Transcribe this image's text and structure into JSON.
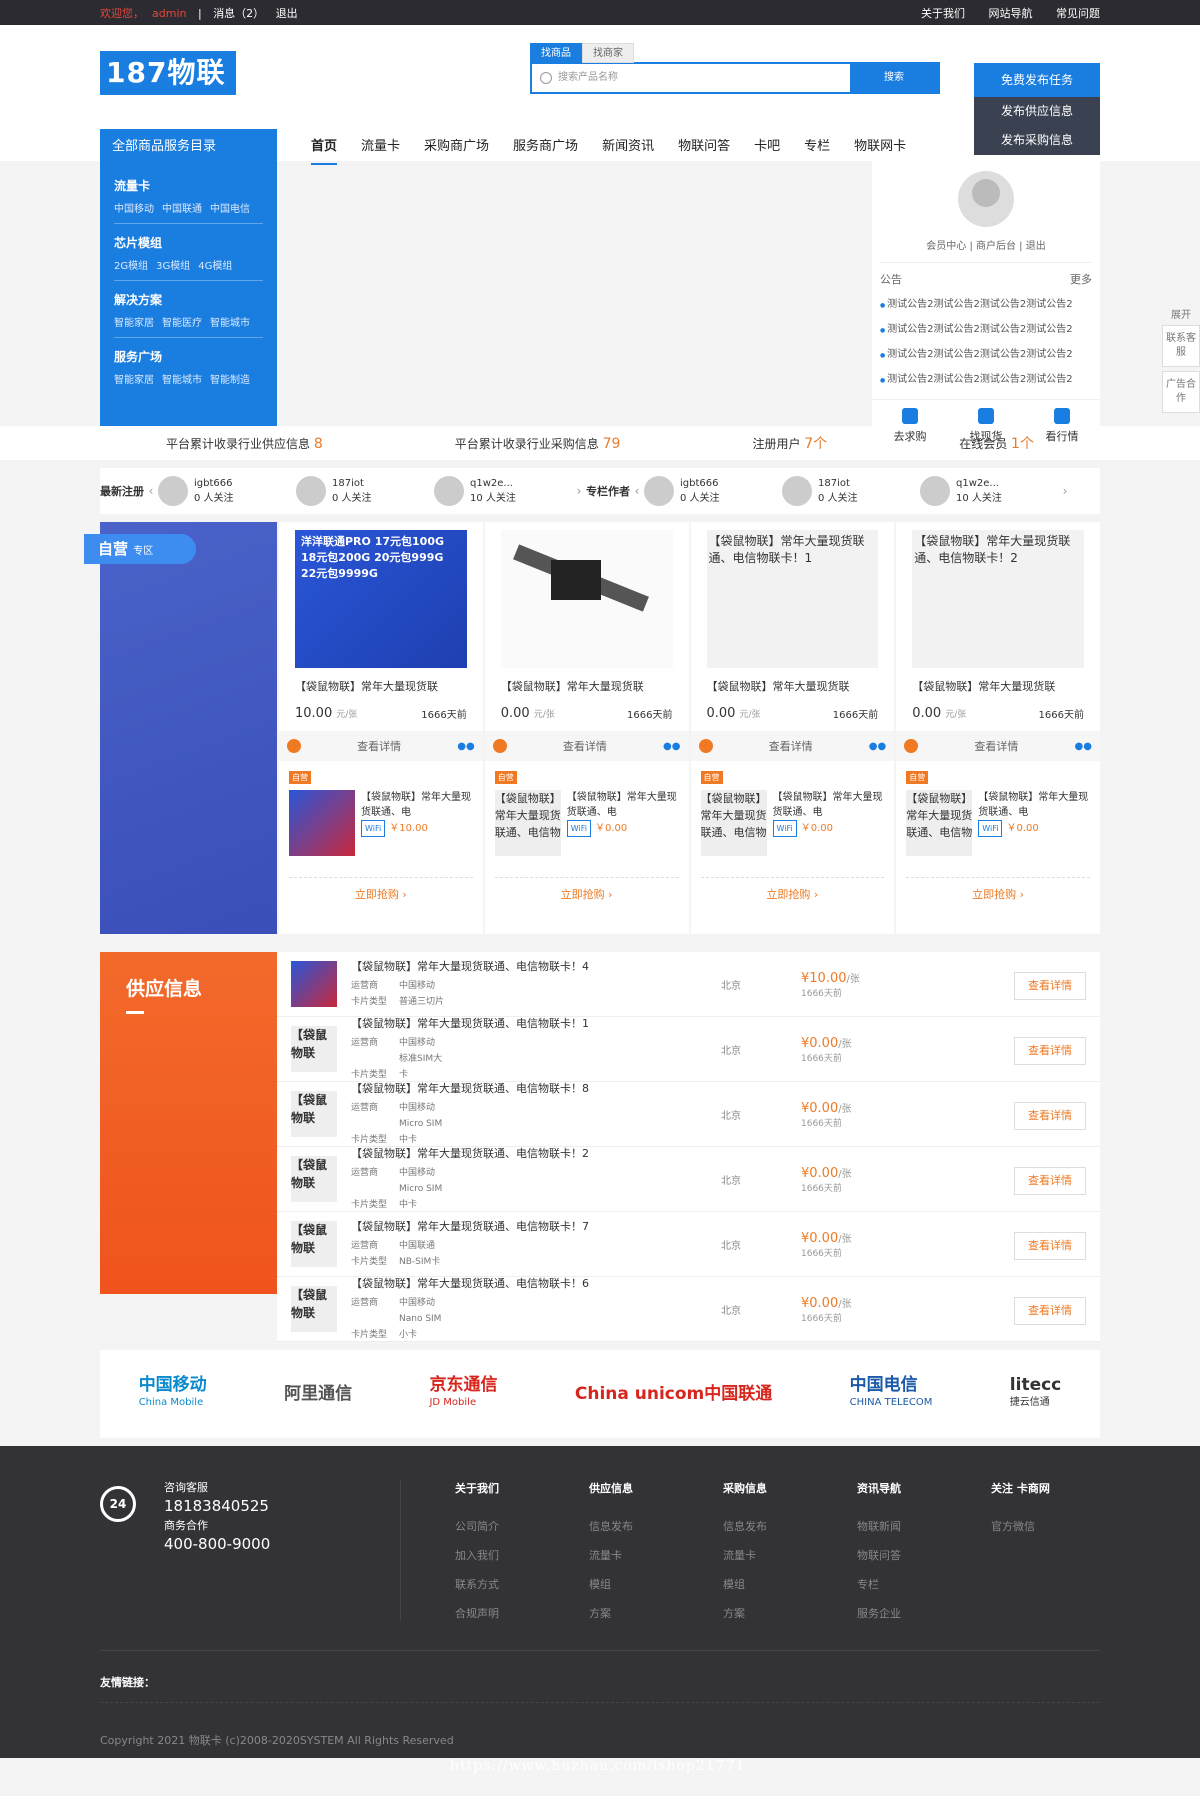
{
  "topbar": {
    "welcome": "欢迎您，",
    "user": "admin",
    "sep": "|",
    "messages": "消息（2）",
    "logout": "退出",
    "links": [
      "关于我们",
      "网站导航",
      "常见问题"
    ]
  },
  "header": {
    "logo": "187物联",
    "search_tabs": [
      "找商品",
      "找商家"
    ],
    "search_placeholder": "搜索产品名称",
    "search_button": "搜索",
    "publish_task": "免费发布任务",
    "publish_supply": "发布供应信息",
    "publish_purchase": "发布采购信息"
  },
  "nav": {
    "catalog": "全部商品服务目录",
    "items": [
      "首页",
      "流量卡",
      "采购商广场",
      "服务商广场",
      "新闻资讯",
      "物联问答",
      "卡吧",
      "专栏",
      "物联网卡"
    ]
  },
  "categories": [
    {
      "title": "流量卡",
      "subs": [
        "中国移动",
        "中国联通",
        "中国电信"
      ]
    },
    {
      "title": "芯片模组",
      "subs": [
        "2G模组",
        "3G模组",
        "4G模组"
      ]
    },
    {
      "title": "解决方案",
      "subs": [
        "智能家居",
        "智能医疗",
        "智能城市"
      ]
    },
    {
      "title": "服务广场",
      "subs": [
        "智能家居",
        "智能城市",
        "智能制造"
      ]
    }
  ],
  "user_panel": {
    "links": "会员中心 | 商户后台 | 退出",
    "notice_title": "公告",
    "more": "更多",
    "notices": [
      "测试公告2测试公告2测试公告2测试公告2",
      "测试公告2测试公告2测试公告2测试公告2",
      "测试公告2测试公告2测试公告2测试公告2",
      "测试公告2测试公告2测试公告2测试公告2"
    ],
    "actions": [
      "去求购",
      "找现货",
      "看行情"
    ]
  },
  "side": {
    "expand": "展开",
    "contact": "联系客服",
    "ad": "广告合作"
  },
  "stats": [
    {
      "label": "平台累计收录行业供应信息",
      "value": "8"
    },
    {
      "label": "平台累计收录行业采购信息",
      "value": "79"
    },
    {
      "label": "注册用户",
      "value": "7个"
    },
    {
      "label": "在线会员",
      "value": "1个"
    }
  ],
  "members": {
    "new_label": "最新注册",
    "author_label": "专栏作者",
    "new": [
      {
        "name": "igbt666",
        "fans": "0 人关注"
      },
      {
        "name": "187iot",
        "fans": "0 人关注"
      },
      {
        "name": "q1w2e...",
        "fans": "10 人关注"
      }
    ],
    "authors": [
      {
        "name": "igbt666",
        "fans": "0 人关注"
      },
      {
        "name": "187iot",
        "fans": "0 人关注"
      },
      {
        "name": "q1w2e...",
        "fans": "10 人关注"
      }
    ]
  },
  "zone": {
    "tag": "自营",
    "tag_small": "专区",
    "cards": [
      {
        "img_text": "洋洋联通PRO 17元包100G 18元包200G 20元包999G 22元包9999G",
        "title": "【袋鼠物联】常年大量现货联",
        "price": "10.00",
        "unit": "元/张",
        "date": "1666天前",
        "view": "查看详情",
        "sub_tag": "自营",
        "sub_title": "【袋鼠物联】常年大量现货联通、电",
        "sub_price": "￥10.00",
        "sub_alt": "",
        "buy": "立即抢购 ›"
      },
      {
        "img_text": "",
        "title": "【袋鼠物联】常年大量现货联",
        "price": "0.00",
        "unit": "元/张",
        "date": "1666天前",
        "view": "查看详情",
        "sub_tag": "自营",
        "sub_title": "【袋鼠物联】常年大量现货联通、电",
        "sub_price": "￥0.00",
        "sub_alt": "【袋鼠物联】常年大量现货联通、电信物",
        "buy": "立即抢购 ›"
      },
      {
        "img_text": "【袋鼠物联】常年大量现货联通、电信物联卡！1",
        "title": "【袋鼠物联】常年大量现货联",
        "price": "0.00",
        "unit": "元/张",
        "date": "1666天前",
        "view": "查看详情",
        "sub_tag": "自营",
        "sub_title": "【袋鼠物联】常年大量现货联通、电",
        "sub_price": "￥0.00",
        "sub_alt": "【袋鼠物联】常年大量现货联通、电信物",
        "buy": "立即抢购 ›"
      },
      {
        "img_text": "【袋鼠物联】常年大量现货联通、电信物联卡！2",
        "title": "【袋鼠物联】常年大量现货联",
        "price": "0.00",
        "unit": "元/张",
        "date": "1666天前",
        "view": "查看详情",
        "sub_tag": "自营",
        "sub_title": "【袋鼠物联】常年大量现货联通、电",
        "sub_price": "￥0.00",
        "sub_alt": "【袋鼠物联】常年大量现货联通、电信物",
        "buy": "立即抢购 ›"
      }
    ]
  },
  "supply": {
    "title": "供应信息",
    "rows": [
      {
        "title": "【袋鼠物联】常年大量现货联通、电信物联卡！4",
        "operator": "中国移动",
        "type": "普通三切片",
        "loc": "北京",
        "price": "¥10.00",
        "unit": "/张",
        "date": "1666天前",
        "thumb": ""
      },
      {
        "title": "【袋鼠物联】常年大量现货联通、电信物联卡！1",
        "operator": "中国移动",
        "type": "标准SIM大卡",
        "loc": "北京",
        "price": "¥0.00",
        "unit": "/张",
        "date": "1666天前",
        "thumb": "【袋鼠物联"
      },
      {
        "title": "【袋鼠物联】常年大量现货联通、电信物联卡！8",
        "operator": "中国移动",
        "type": "Micro SIM中卡",
        "loc": "北京",
        "price": "¥0.00",
        "unit": "/张",
        "date": "1666天前",
        "thumb": "【袋鼠物联"
      },
      {
        "title": "【袋鼠物联】常年大量现货联通、电信物联卡！2",
        "operator": "中国移动",
        "type": "Micro SIM中卡",
        "loc": "北京",
        "price": "¥0.00",
        "unit": "/张",
        "date": "1666天前",
        "thumb": "【袋鼠物联"
      },
      {
        "title": "【袋鼠物联】常年大量现货联通、电信物联卡！7",
        "operator": "中国联通",
        "type": "NB-SIM卡",
        "loc": "北京",
        "price": "¥0.00",
        "unit": "/张",
        "date": "1666天前",
        "thumb": "【袋鼠物联"
      },
      {
        "title": "【袋鼠物联】常年大量现货联通、电信物联卡！6",
        "operator": "中国移动",
        "type": "Nano SIM小卡",
        "loc": "北京",
        "price": "¥0.00",
        "unit": "/张",
        "date": "1666天前",
        "thumb": "【袋鼠物联"
      }
    ],
    "operator_label": "运营商",
    "type_label": "卡片类型",
    "detail": "查看详情"
  },
  "partners": [
    {
      "name": "中国移动",
      "sub": "China Mobile",
      "color": "#0a8acd"
    },
    {
      "name": "阿里通信",
      "sub": "",
      "color": "#555555"
    },
    {
      "name": "京东通信",
      "sub": "JD Mobile",
      "color": "#d7261e"
    },
    {
      "name": "China unicom中国联通",
      "sub": "",
      "color": "#d7261e"
    },
    {
      "name": "中国电信",
      "sub": "CHINA TELECOM",
      "color": "#1b5aa8"
    },
    {
      "name": "litecc",
      "sub": "捷云信通",
      "color": "#333333"
    }
  ],
  "footer": {
    "phone_icon": "24",
    "consult": "咨询客服",
    "phone": "18183840525",
    "biz": "商务合作",
    "biz_phone": "400-800-9000",
    "cols": [
      {
        "title": "关于我们",
        "items": [
          "公司简介",
          "加入我们",
          "联系方式",
          "合规声明"
        ]
      },
      {
        "title": "供应信息",
        "items": [
          "信息发布",
          "流量卡",
          "模组",
          "方案"
        ]
      },
      {
        "title": "采购信息",
        "items": [
          "信息发布",
          "流量卡",
          "模组",
          "方案"
        ]
      },
      {
        "title": "资讯导航",
        "items": [
          "物联新闻",
          "物联问答",
          "专栏",
          "服务企业"
        ]
      },
      {
        "title": "关注 卡商网",
        "items": [
          "官方微信"
        ]
      }
    ],
    "links": "友情链接：",
    "copyright": "Copyright 2021 物联卡 (c)2008-2020SYSTEM All Rights Reserved"
  },
  "watermark": "https://www.huzhan.com/ishop21771"
}
